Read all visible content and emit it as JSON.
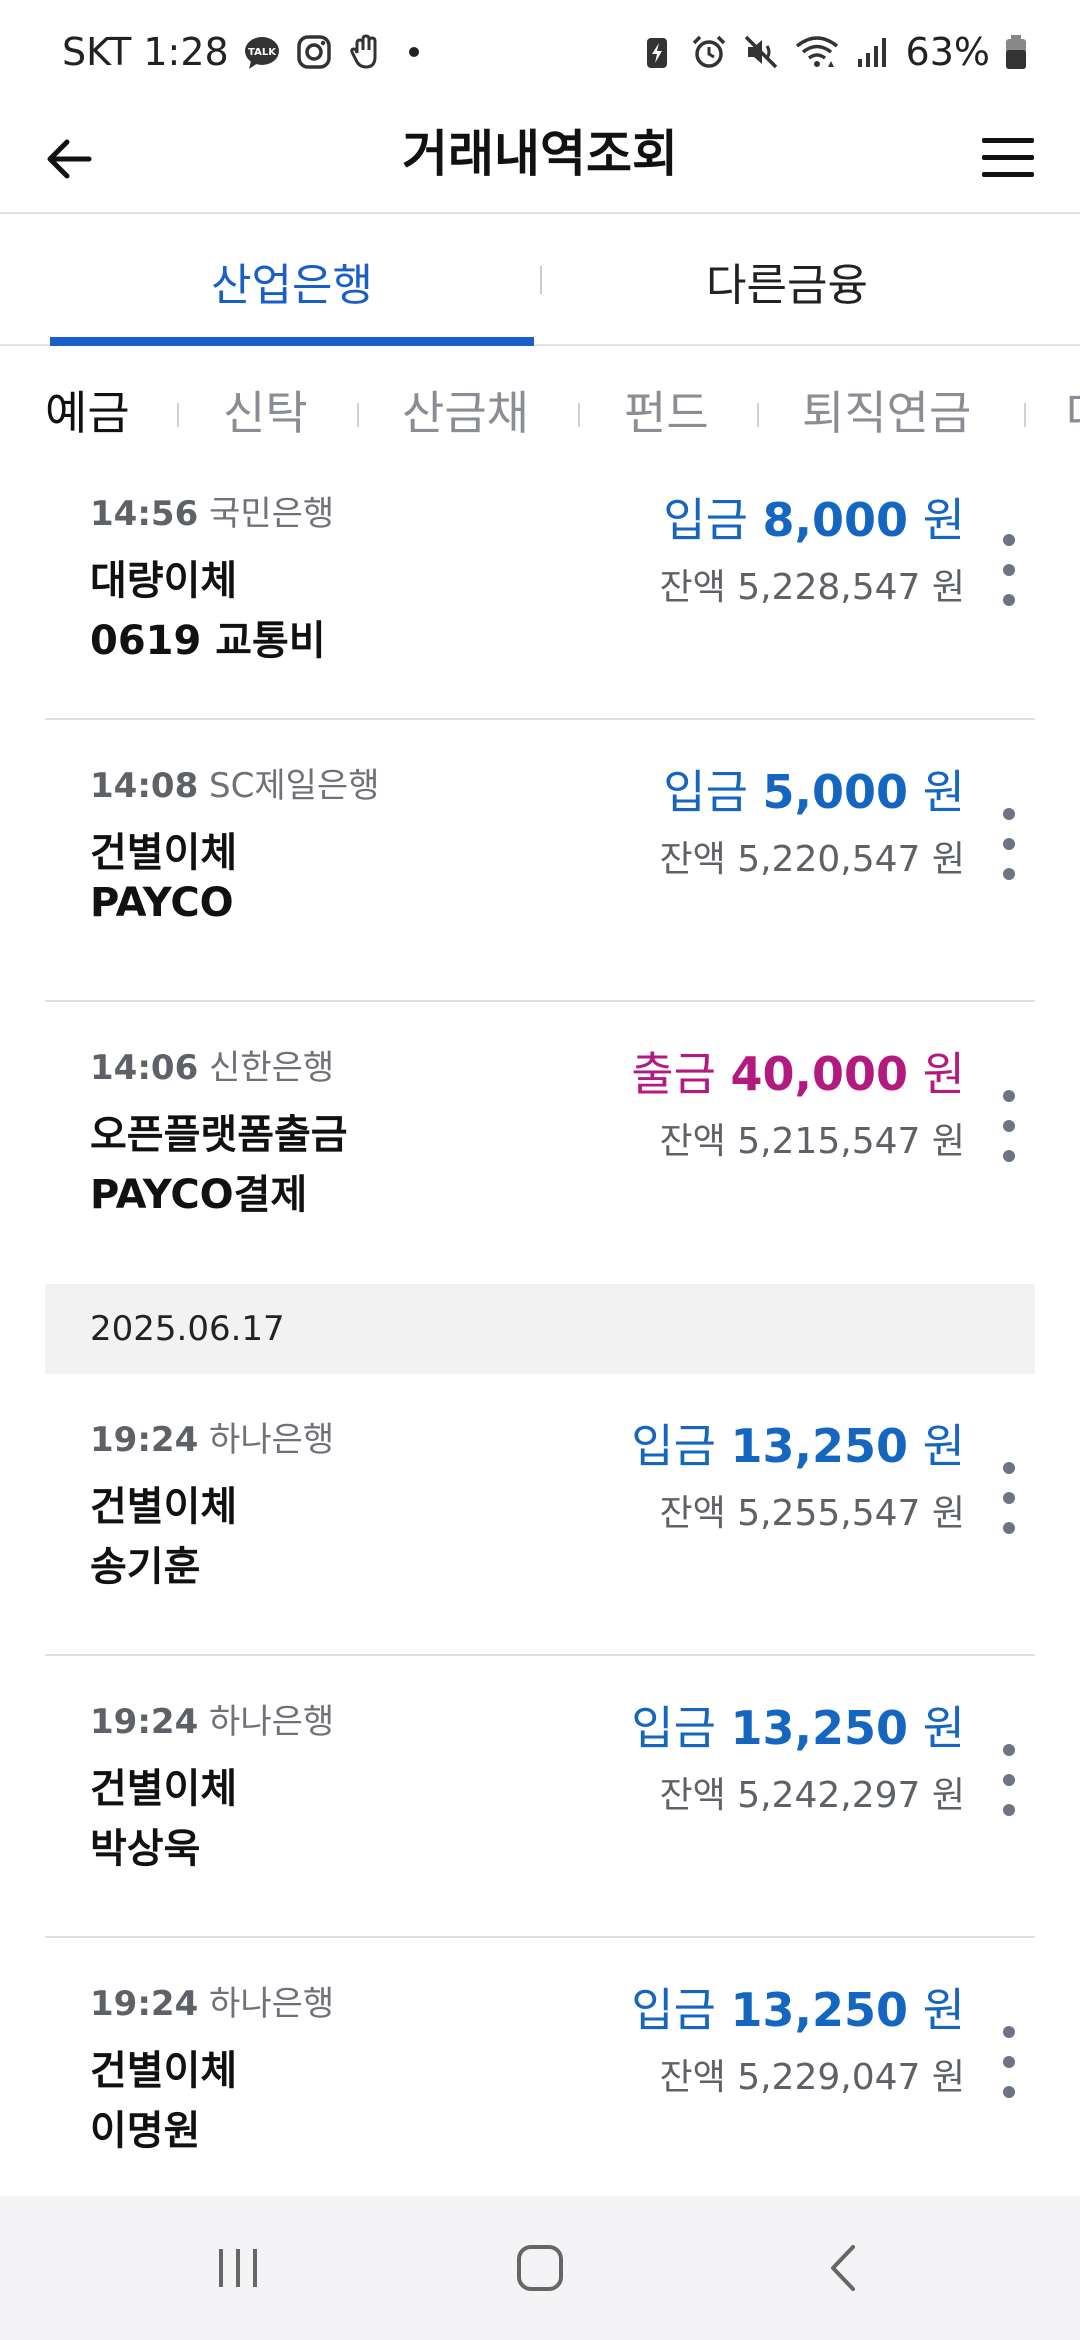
{
  "status_bar": {
    "time": "SKT 1:28",
    "battery": "63%",
    "left_icons": [
      "talk-icon",
      "instagram-icon",
      "hand-icon",
      "dot-icon"
    ],
    "right_icons": [
      "battery-saver-icon",
      "alarm-icon",
      "mute-icon",
      "wifi-icon",
      "signal-icon",
      "battery-icon"
    ]
  },
  "header": {
    "title": "거래내역조회",
    "back_icon": "arrow-left-icon",
    "menu_icon": "hamburger-menu-icon"
  },
  "main_tabs": [
    {
      "label": "산업은행",
      "active": true
    },
    {
      "label": "다른금융",
      "active": false
    }
  ],
  "sub_tabs": [
    {
      "label": "예금",
      "active": true
    },
    {
      "label": "신탁",
      "active": false
    },
    {
      "label": "산금채",
      "active": false
    },
    {
      "label": "펀드",
      "active": false
    },
    {
      "label": "퇴직연금",
      "active": false
    },
    {
      "label": "대",
      "active": false
    }
  ],
  "transactions_top": [
    {
      "time": "14:56",
      "bank": "국민은행",
      "line1": "대량이체",
      "line2": "0619 교통비",
      "type": "입금",
      "amount": "8,000",
      "unit": "원",
      "balance": "잔액 5,228,547 원"
    },
    {
      "time": "14:08",
      "bank": "SC제일은행",
      "line1": "건별이체",
      "line2": "PAYCO",
      "type": "입금",
      "amount": "5,000",
      "unit": "원",
      "balance": "잔액 5,220,547 원"
    },
    {
      "time": "14:06",
      "bank": "신한은행",
      "line1": "오픈플랫폼출금",
      "line2": "PAYCO결제",
      "type": "출금",
      "amount": "40,000",
      "unit": "원",
      "balance": "잔액 5,215,547 원"
    }
  ],
  "date_header": "2025.06.17",
  "transactions_bottom": [
    {
      "time": "19:24",
      "bank": "하나은행",
      "line1": "건별이체",
      "line2": "송기훈",
      "type": "입금",
      "amount": "13,250",
      "unit": "원",
      "balance": "잔액 5,255,547 원"
    },
    {
      "time": "19:24",
      "bank": "하나은행",
      "line1": "건별이체",
      "line2": "박상욱",
      "type": "입금",
      "amount": "13,250",
      "unit": "원",
      "balance": "잔액 5,242,297 원"
    },
    {
      "time": "19:24",
      "bank": "하나은행",
      "line1": "건별이체",
      "line2": "이명원",
      "type": "입금",
      "amount": "13,250",
      "unit": "원",
      "balance": "잔액 5,229,047 원"
    }
  ],
  "colors": {
    "accent": "#1a5fc8",
    "deposit": "#1566c0",
    "withdrawal": "#b31a7f"
  },
  "nav_bar": {
    "icons": [
      "recents-icon",
      "home-icon",
      "back-icon"
    ]
  }
}
